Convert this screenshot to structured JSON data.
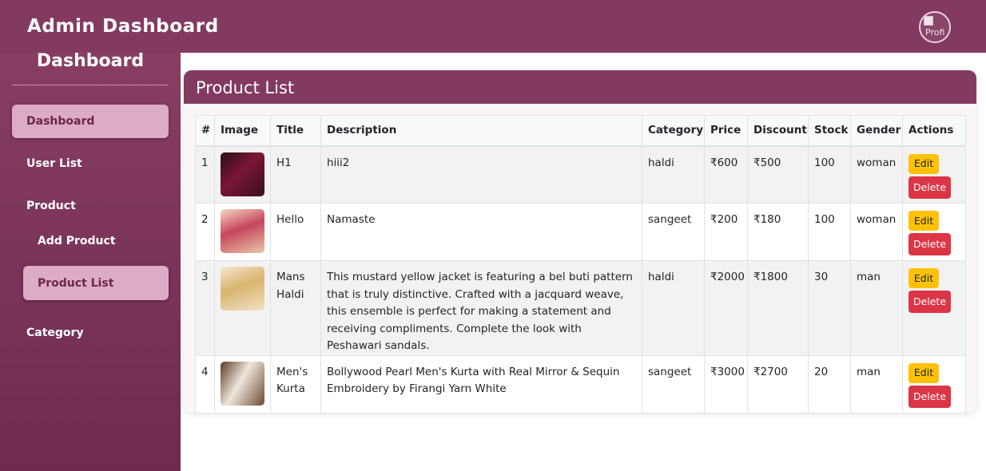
{
  "header": {
    "app_title": "Admin Dashboard",
    "avatar_alt": "Profi"
  },
  "sidebar": {
    "heading": "Dashboard",
    "items": [
      {
        "label": "Dashboard"
      },
      {
        "label": "User List"
      },
      {
        "label": "Product"
      },
      {
        "label": "Add Product"
      },
      {
        "label": "Product List"
      },
      {
        "label": "Category"
      }
    ]
  },
  "main": {
    "title": "Product List",
    "table": {
      "columns": [
        "#",
        "Image",
        "Title",
        "Description",
        "Category",
        "Price",
        "Discount",
        "Stock",
        "Gender",
        "Actions"
      ],
      "edit_label": "Edit",
      "delete_label": "Delete",
      "rows": [
        {
          "num": "1",
          "title": "H1",
          "description": "hiii2",
          "category": "haldi",
          "price": "₹600",
          "discount": "₹500",
          "stock": "100",
          "gender": "woman"
        },
        {
          "num": "2",
          "title": "Hello",
          "description": "Namaste",
          "category": "sangeet",
          "price": "₹200",
          "discount": "₹180",
          "stock": "100",
          "gender": "woman"
        },
        {
          "num": "3",
          "title": "Mans Haldi",
          "description": "This mustard yellow jacket is featuring a bel buti pattern that is truly distinctive. Crafted with a jacquard weave, this ensemble is perfect for making a statement and receiving compliments. Complete the look with Peshawari sandals.",
          "category": "haldi",
          "price": "₹2000",
          "discount": "₹1800",
          "stock": "30",
          "gender": "man"
        },
        {
          "num": "4",
          "title": "Men's Kurta",
          "description": "Bollywood Pearl Men's Kurta with Real Mirror & Sequin Embroidery by Firangi Yarn White",
          "category": "sangeet",
          "price": "₹3000",
          "discount": "₹2700",
          "stock": "20",
          "gender": "man"
        }
      ]
    }
  },
  "colors": {
    "brand": "#833a61",
    "active_nav": "#dcabc6",
    "edit": "#ffc107",
    "delete": "#dc3545"
  }
}
